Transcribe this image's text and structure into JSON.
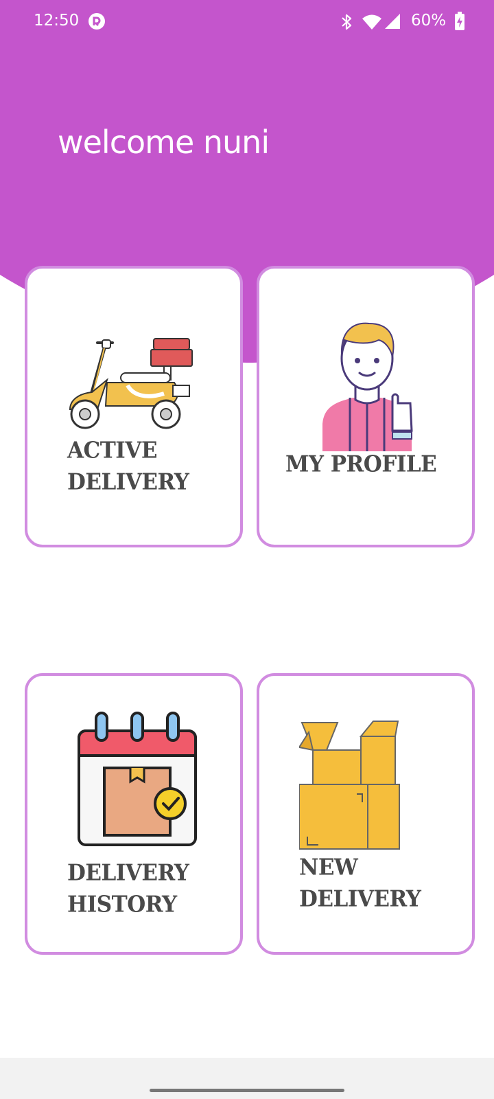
{
  "status_bar": {
    "time": "12:50",
    "battery_percent": "60%",
    "icons": [
      "app-notification-icon",
      "bluetooth-icon",
      "wifi-icon",
      "cell-signal-icon",
      "battery-charging-icon"
    ]
  },
  "header": {
    "welcome_text": "welcome nuni",
    "background_color": "#c455cc"
  },
  "cards": {
    "active_delivery": {
      "line1": "ACTIVE",
      "line2": "DELIVERY",
      "icon": "scooter-icon"
    },
    "my_profile": {
      "line1": "MY PROFILE",
      "icon": "profile-person-icon"
    },
    "delivery_history": {
      "line1": "DELIVERY",
      "line2": "HISTORY",
      "icon": "calendar-package-icon"
    },
    "new_delivery": {
      "line1": "NEW",
      "line2": "DELIVERY",
      "icon": "boxes-icon"
    }
  },
  "colors": {
    "accent": "#c455cc",
    "card_border": "#d18ce0",
    "label_text": "#4a4a4a"
  }
}
